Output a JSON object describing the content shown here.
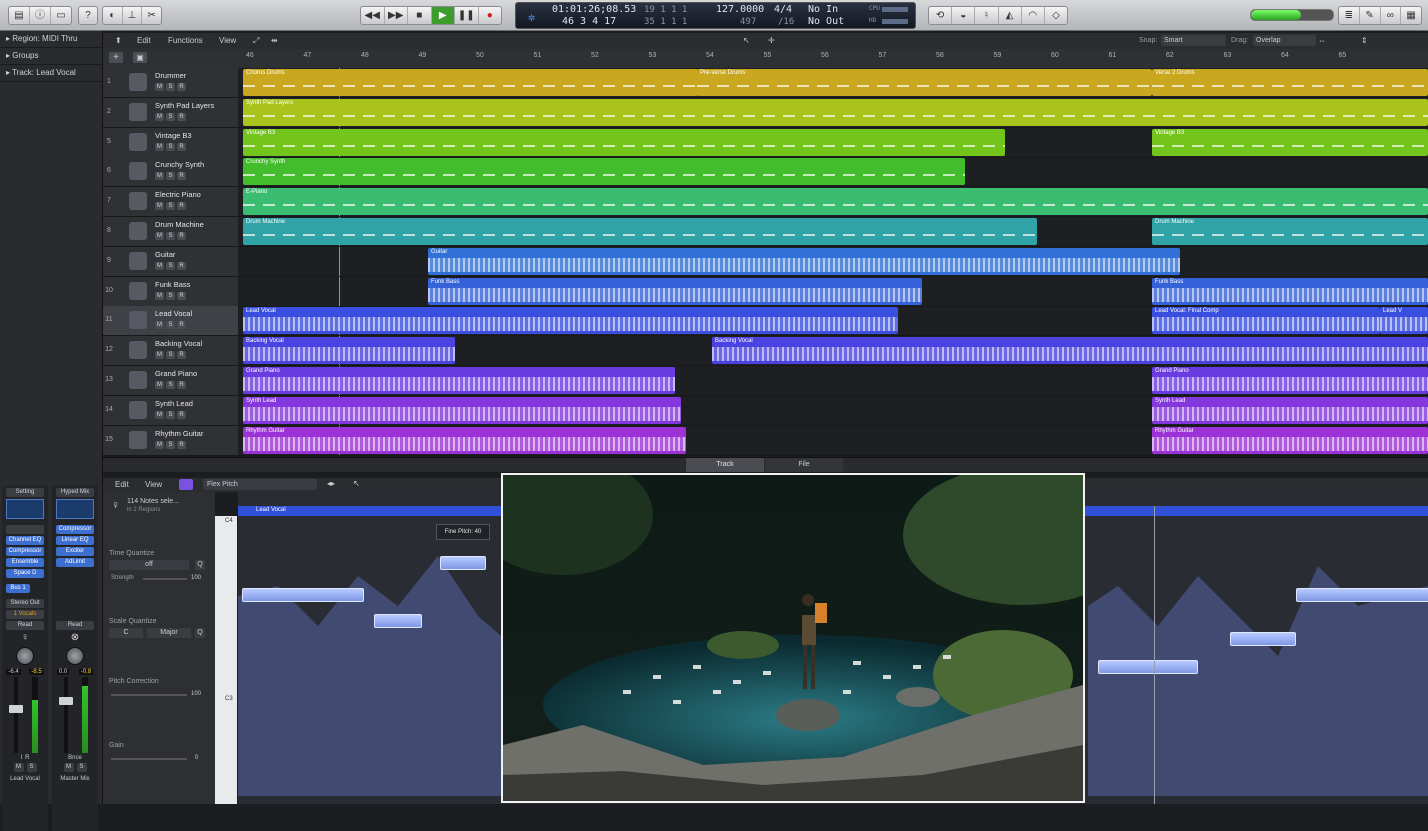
{
  "toolbar": {
    "transport": {
      "rewind": "◀◀",
      "forward": "▶▶",
      "stop": "■",
      "play": "▶",
      "pause": "❚❚",
      "record": "●"
    },
    "lcd": {
      "time": "01:01:26;08.53",
      "time_sub": "19  1  1   1",
      "bars": "46  3  4   17",
      "bars_sub": "35  1  1   1",
      "tempo": "127.0000",
      "tempo_sub": "497",
      "signature": "4/4",
      "signature_sub": "/16",
      "midi_in": "No In",
      "midi_out": "No Out",
      "cpu": "CPU",
      "hd": "HD"
    }
  },
  "inspector": {
    "region": "Region: MIDI Thru",
    "groups": "Groups",
    "track": "Track: Lead Vocal",
    "strip1": {
      "setting": "Setting",
      "plugins": [
        "Channel EQ",
        "Compressor",
        "Ensemble",
        "Space D"
      ],
      "bus": "Bus 1",
      "output": "Stereo Out",
      "group": "1 Vocals",
      "automation": "Read",
      "vol": "-6.4",
      "peak": "-8.5",
      "name": "Lead Vocal",
      "m": "M",
      "s": "S",
      "i": "I",
      "r": "R"
    },
    "strip2": {
      "setting": "Hyped Mix",
      "plugins": [
        "Compressor",
        "Linear EQ",
        "Exciter",
        "AdLimit"
      ],
      "automation": "Read",
      "vol": "0.0",
      "peak": "-0.8",
      "name": "Master Mix",
      "bnce": "Bnce",
      "m": "M",
      "s": "S"
    }
  },
  "tracks_toolbar": {
    "edit": "Edit",
    "functions": "Functions",
    "view": "View",
    "snap_label": "Snap:",
    "snap": "Smart",
    "drag_label": "Drag:",
    "drag": "Overlap"
  },
  "ruler": [
    "46",
    "47",
    "48",
    "49",
    "50",
    "51",
    "52",
    "53",
    "54",
    "55",
    "56",
    "57",
    "58",
    "59",
    "60",
    "61",
    "62",
    "63",
    "64",
    "65"
  ],
  "tracks": [
    {
      "num": "1",
      "name": "Drummer",
      "color": "#c9a81f"
    },
    {
      "num": "2",
      "name": "Synth Pad Layers",
      "color": "#a9c21c"
    },
    {
      "num": "5",
      "name": "Vintage B3",
      "color": "#73c51b"
    },
    {
      "num": "6",
      "name": "Crunchy Synth",
      "color": "#43bd2b"
    },
    {
      "num": "7",
      "name": "Electric Piano",
      "color": "#3bbd71"
    },
    {
      "num": "8",
      "name": "Drum Machine",
      "color": "#2fa3a6"
    },
    {
      "num": "9",
      "name": "Guitar",
      "color": "#3170d6"
    },
    {
      "num": "10",
      "name": "Funk Bass",
      "color": "#3662d9"
    },
    {
      "num": "11",
      "name": "Lead Vocal",
      "color": "#3a4fe0"
    },
    {
      "num": "12",
      "name": "Backing Vocal",
      "color": "#4a43e0"
    },
    {
      "num": "13",
      "name": "Grand Piano",
      "color": "#6a3be0"
    },
    {
      "num": "14",
      "name": "Synth Lead",
      "color": "#8437dc"
    },
    {
      "num": "15",
      "name": "Rhythm Guitar",
      "color": "#9c32d6"
    }
  ],
  "regions": [
    [
      "Chorus Drums",
      "Pre-verse Drums",
      "Verse 2 Drums"
    ],
    [
      "Synth Pad Layers"
    ],
    [
      "Vintage B3",
      "Vintage B3"
    ],
    [
      "Crunchy Synth"
    ],
    [
      "E-Piano"
    ],
    [
      "Drum Machine",
      "Drum Machine"
    ],
    [
      "Guitar"
    ],
    [
      "Funk Bass",
      "Funk Bass"
    ],
    [
      "Lead Vocal",
      "Lead Vocal: Final Comp",
      "Lead V"
    ],
    [
      "Backing Vocal",
      "Backing Vocal"
    ],
    [
      "Grand Piano",
      "Grand Piano"
    ],
    [
      "Synth Lead",
      "Synth Lead"
    ],
    [
      "Rhythm Guitar",
      "Rhythm Guitar"
    ]
  ],
  "editor": {
    "tab_track": "Track",
    "tab_file": "File",
    "edit": "Edit",
    "view": "View",
    "mode": "Flex Pitch",
    "ruler": [
      "45",
      "45.1.3",
      "45.2",
      "45.2.3",
      "46.3.3",
      "46.4",
      "46.4.3",
      "47",
      "47.1.3"
    ],
    "selection": "114 Notes sele...",
    "selection_sub": "in 2 Regions",
    "time_quantize": "Time Quantize",
    "tq_value": "off",
    "strength": "Strength",
    "strength_val": "100",
    "scale_quantize": "Scale Quantize",
    "key": "C",
    "scale": "Major",
    "pitch_correction": "Pitch Correction",
    "pc_val": "100",
    "gain": "Gain",
    "gain_val": "0",
    "region_label": "Lead Vocal",
    "tooltip": "Fine Pitch: 40",
    "c4": "C4",
    "c3": "C3",
    "q": "Q"
  }
}
